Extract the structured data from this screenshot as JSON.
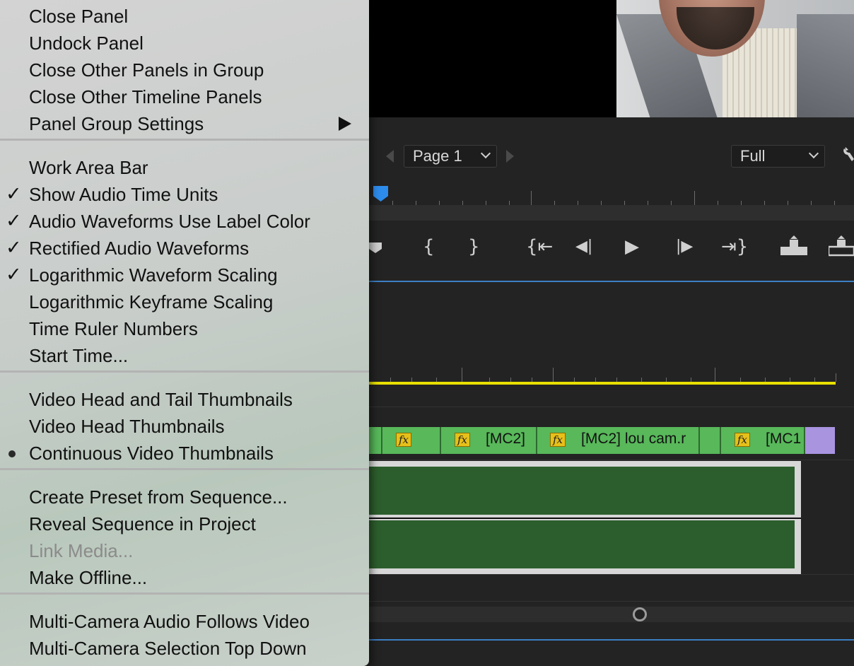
{
  "menu": {
    "groups": [
      [
        {
          "label": "Close Panel",
          "check": "",
          "bullet": false,
          "submenu": false,
          "disabled": false
        },
        {
          "label": "Undock Panel",
          "check": "",
          "bullet": false,
          "submenu": false,
          "disabled": false
        },
        {
          "label": "Close Other Panels in Group",
          "check": "",
          "bullet": false,
          "submenu": false,
          "disabled": false
        },
        {
          "label": "Close Other Timeline Panels",
          "check": "",
          "bullet": false,
          "submenu": false,
          "disabled": false
        },
        {
          "label": "Panel Group Settings",
          "check": "",
          "bullet": false,
          "submenu": true,
          "disabled": false
        }
      ],
      [
        {
          "label": "Work Area Bar",
          "check": "",
          "bullet": false,
          "submenu": false,
          "disabled": false
        },
        {
          "label": "Show Audio Time Units",
          "check": "✓",
          "bullet": false,
          "submenu": false,
          "disabled": false
        },
        {
          "label": "Audio Waveforms Use Label Color",
          "check": "✓",
          "bullet": false,
          "submenu": false,
          "disabled": false
        },
        {
          "label": "Rectified Audio Waveforms",
          "check": "✓",
          "bullet": false,
          "submenu": false,
          "disabled": false
        },
        {
          "label": "Logarithmic Waveform Scaling",
          "check": "✓",
          "bullet": false,
          "submenu": false,
          "disabled": false
        },
        {
          "label": "Logarithmic Keyframe Scaling",
          "check": "",
          "bullet": false,
          "submenu": false,
          "disabled": false
        },
        {
          "label": "Time Ruler Numbers",
          "check": "",
          "bullet": false,
          "submenu": false,
          "disabled": false
        },
        {
          "label": "Start Time...",
          "check": "",
          "bullet": false,
          "submenu": false,
          "disabled": false
        }
      ],
      [
        {
          "label": "Video Head and Tail Thumbnails",
          "check": "",
          "bullet": false,
          "submenu": false,
          "disabled": false
        },
        {
          "label": "Video Head Thumbnails",
          "check": "",
          "bullet": false,
          "submenu": false,
          "disabled": false
        },
        {
          "label": "Continuous Video Thumbnails",
          "check": "",
          "bullet": true,
          "submenu": false,
          "disabled": false
        }
      ],
      [
        {
          "label": "Create Preset from Sequence...",
          "check": "",
          "bullet": false,
          "submenu": false,
          "disabled": false
        },
        {
          "label": "Reveal Sequence in Project",
          "check": "",
          "bullet": false,
          "submenu": false,
          "disabled": false
        },
        {
          "label": "Link Media...",
          "check": "",
          "bullet": false,
          "submenu": false,
          "disabled": true
        },
        {
          "label": "Make Offline...",
          "check": "",
          "bullet": false,
          "submenu": false,
          "disabled": false
        }
      ],
      [
        {
          "label": "Multi-Camera Audio Follows Video",
          "check": "",
          "bullet": false,
          "submenu": false,
          "disabled": false
        },
        {
          "label": "Multi-Camera Selection Top Down",
          "check": "",
          "bullet": false,
          "submenu": false,
          "disabled": false
        }
      ]
    ]
  },
  "monitor": {
    "page_label": "Page 1",
    "zoom_label": "Full"
  },
  "transport": {
    "marker_icon": "marker-icon",
    "mark_in": "{",
    "mark_out": "}",
    "go_to_in": "{⇤",
    "step_back": "◀|",
    "play": "▶",
    "step_forward": "|▶",
    "go_to_out": "⇥}",
    "lift_icon": "lift-icon",
    "extract_icon": "extract-icon"
  },
  "timeline": {
    "clips": [
      {
        "label": "",
        "fx": false
      },
      {
        "label": "",
        "fx": true
      },
      {
        "label": "[MC2]",
        "fx": true
      },
      {
        "label": "[MC2] lou cam.r",
        "fx": true
      },
      {
        "label": "",
        "fx": false
      },
      {
        "label": "[MC1",
        "fx": true
      }
    ],
    "fx_label": "fx"
  },
  "colors": {
    "accent_blue": "#2d8ceb",
    "work_area": "#e8e000",
    "video_clip": "#58b85a",
    "audio_clip": "#2c5e2d",
    "adjustment_clip": "#a994e0",
    "fx_badge": "#e7c019"
  }
}
